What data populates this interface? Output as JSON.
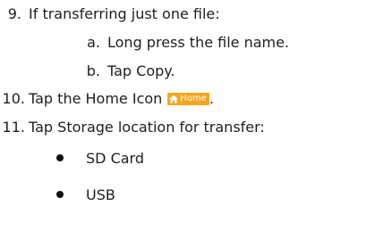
{
  "steps": [
    {
      "number": "9.",
      "text": "If transferring just one file:"
    },
    {
      "number": "10.",
      "text": "Tap the Home Icon",
      "badge": "Home",
      "suffix": "."
    },
    {
      "number": "11.",
      "text": "Tap Storage location for transfer:"
    }
  ],
  "substeps": [
    {
      "letter": "a.",
      "text": "Long press the file name."
    },
    {
      "letter": "b.",
      "text": "Tap Copy."
    }
  ],
  "bullets": [
    "SD Card",
    "USB"
  ],
  "colors": {
    "badge_background": "#f7a51c",
    "badge_text": "#ffffff",
    "text": "#1e1e1e"
  },
  "icons": {
    "home_badge_icon": "home-icon"
  }
}
